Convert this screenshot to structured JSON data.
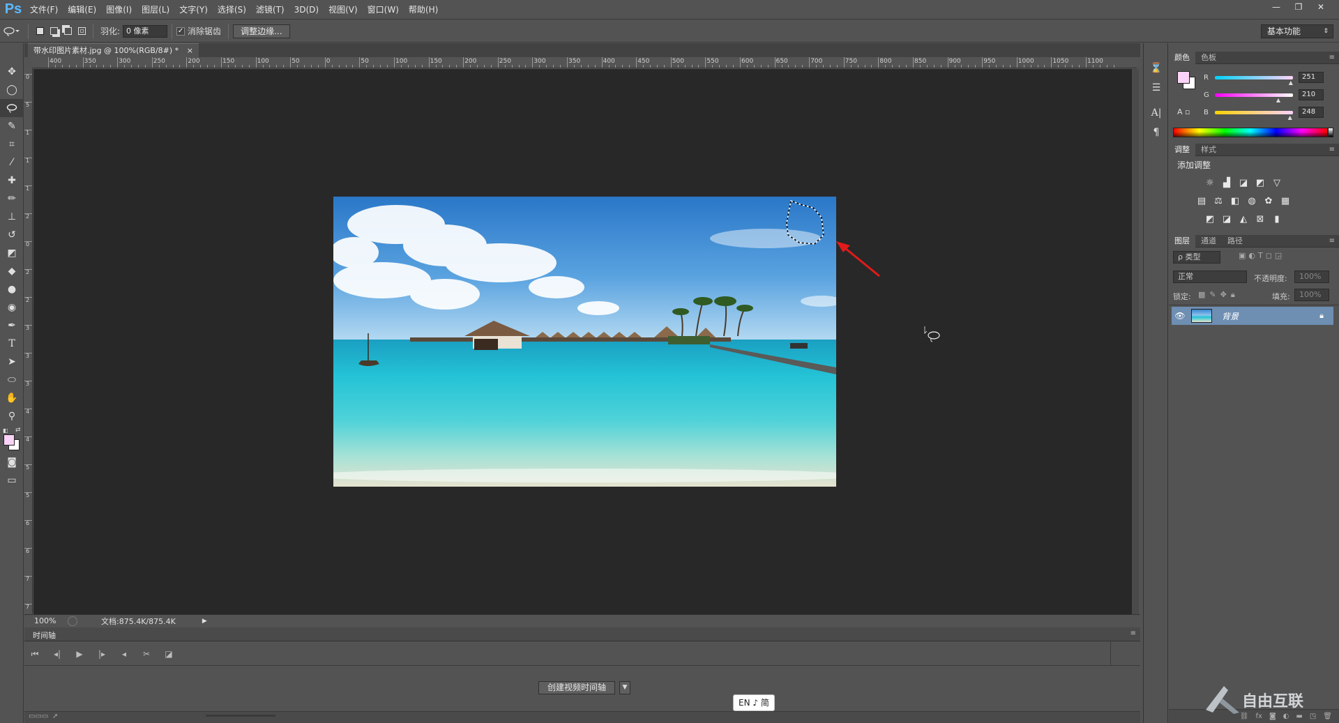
{
  "app": {
    "logo": "Ps"
  },
  "menu": [
    "文件(F)",
    "编辑(E)",
    "图像(I)",
    "图层(L)",
    "文字(Y)",
    "选择(S)",
    "滤镜(T)",
    "3D(D)",
    "视图(V)",
    "窗口(W)",
    "帮助(H)"
  ],
  "window_controls": {
    "minimize": "—",
    "restore": "❐",
    "close": "✕"
  },
  "options": {
    "feather_label": "羽化:",
    "feather_value": "0 像素",
    "antialias_label": "消除锯齿",
    "antialias_checked": "✓",
    "refine_edge_label": "调整边缘...",
    "workspace": "基本功能"
  },
  "document": {
    "tab_title": "带水印图片素材.jpg @ 100%(RGB/8#) *",
    "tab_close": "×"
  },
  "ruler_h": [
    "400",
    "350",
    "300",
    "250",
    "200",
    "150",
    "100",
    "50",
    "0",
    "50",
    "100",
    "150",
    "200",
    "250",
    "300",
    "350",
    "400",
    "450",
    "500",
    "550",
    "600",
    "650",
    "700",
    "750",
    "800",
    "850",
    "900",
    "950",
    "1000",
    "1050",
    "1100"
  ],
  "ruler_v": [
    "0",
    "5",
    "1",
    "1",
    "1",
    "2",
    "0",
    "2",
    "2",
    "3",
    "3",
    "3",
    "4",
    "4",
    "5",
    "5",
    "6",
    "6",
    "7",
    "7"
  ],
  "status": {
    "zoom": "100%",
    "doc_info": "文档:875.4K/875.4K"
  },
  "timeline": {
    "title": "时间轴",
    "create_button": "创建视频时间轴",
    "dropdown": "▼"
  },
  "ime": {
    "text": "EN ♪ 简"
  },
  "color_panel": {
    "tabs": [
      "颜色",
      "色板"
    ],
    "r_label": "R",
    "g_label": "G",
    "b_label": "B",
    "r_value": "251",
    "g_value": "210",
    "b_value": "248",
    "fg_color": "#fbd2f8",
    "r_fill": 0.98,
    "g_fill": 0.82,
    "b_fill": 0.97
  },
  "adjust_panel": {
    "tabs": [
      "调整",
      "样式"
    ],
    "add_label": "添加调整"
  },
  "layers_panel": {
    "tabs": [
      "图层",
      "通道",
      "路径"
    ],
    "filter_label": "ρ 类型",
    "blend_mode": "正常",
    "opacity_label": "不透明度:",
    "opacity_value": "100%",
    "lock_label": "锁定:",
    "fill_label": "填充:",
    "fill_value": "100%",
    "layer_name": "背景"
  },
  "watermark": {
    "text": "自由互联"
  },
  "colors": {
    "accent_blue": "#5cb9ff",
    "selected_layer": "#6e8eb2",
    "annotation_arrow": "#e01b1b"
  }
}
